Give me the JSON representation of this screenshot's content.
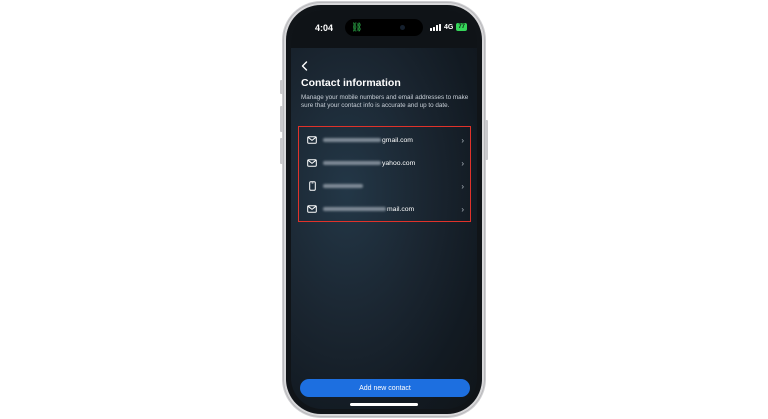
{
  "status_bar": {
    "time": "4:04",
    "network": "4G",
    "battery": "77",
    "active_app_icon": "link-icon",
    "battery_color": "#36d65a"
  },
  "header": {
    "back_icon": "chevron-left-icon",
    "title": "Contact information",
    "description": "Manage your mobile numbers and email addresses to make sure that your contact info is accurate and up to date."
  },
  "contacts": [
    {
      "icon": "mail-icon",
      "visible_text": "gmail.com"
    },
    {
      "icon": "mail-icon",
      "visible_text": "yahoo.com"
    },
    {
      "icon": "phone-icon",
      "visible_text": ""
    },
    {
      "icon": "mail-icon",
      "visible_text": "mail.com"
    }
  ],
  "footer": {
    "add_button_label": "Add new contact",
    "accent_color": "#1d6fe0"
  },
  "highlight_color": "#e0322a"
}
